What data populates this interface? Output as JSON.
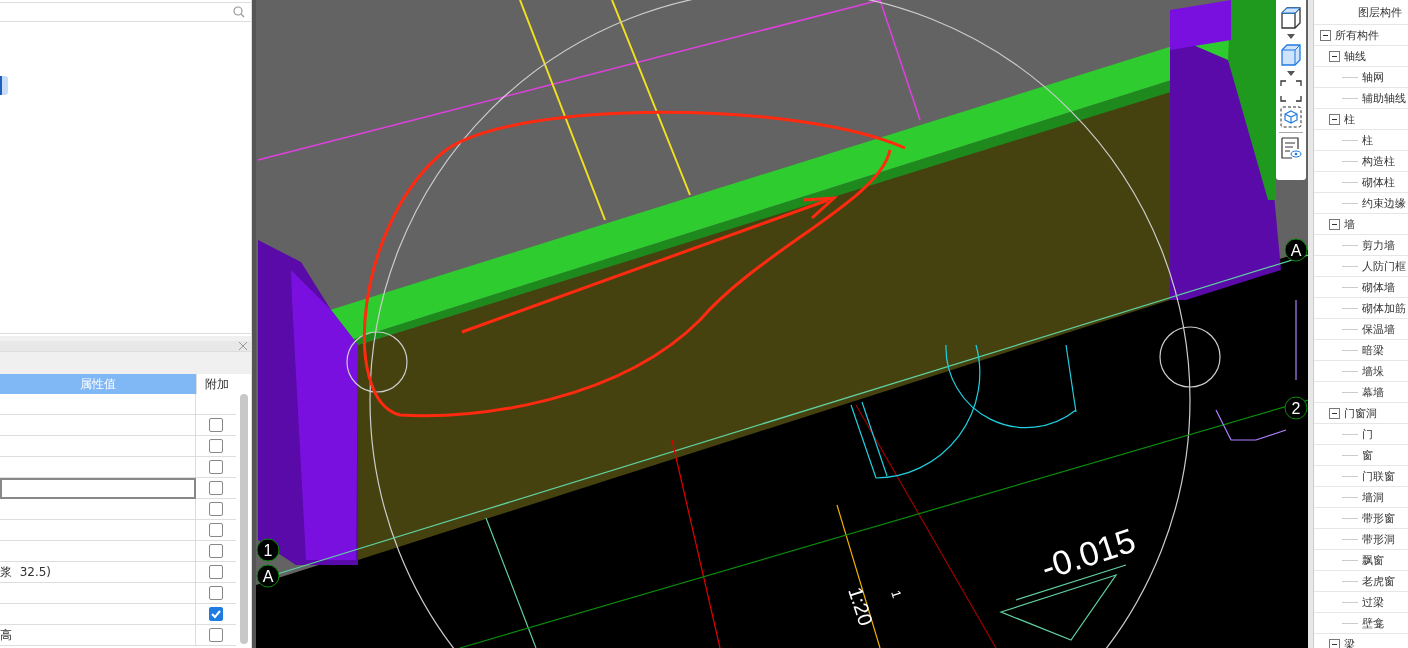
{
  "left_list": {
    "items": [
      {
        "selected": true
      }
    ]
  },
  "properties": {
    "columns": [
      "属性值",
      "附加"
    ],
    "rows": [
      {
        "kind": "group",
        "selected": false
      },
      {
        "kind": "field",
        "checked": false,
        "selected": false
      },
      {
        "kind": "field",
        "checked": false,
        "selected": false
      },
      {
        "kind": "field",
        "checked": false,
        "selected": false
      },
      {
        "kind": "field",
        "checked": false,
        "selected": true
      },
      {
        "kind": "field",
        "checked": false,
        "selected": false
      },
      {
        "kind": "field",
        "checked": false,
        "selected": false
      },
      {
        "kind": "field",
        "checked": false,
        "selected": false
      },
      {
        "kind": "field",
        "value": "浆  32.5)",
        "checked": false,
        "selected": false
      },
      {
        "kind": "field",
        "checked": false,
        "selected": false
      },
      {
        "kind": "field",
        "checked": true,
        "selected": false
      },
      {
        "kind": "field",
        "value": "高",
        "checked": false,
        "selected": false
      }
    ]
  },
  "view": {
    "axis_labels": [
      "A",
      "2",
      "1",
      "A"
    ],
    "elevation": "-0.015",
    "scale": "1:20",
    "tick": "1"
  },
  "tree": {
    "header": "图层构件",
    "items": [
      {
        "label": "所有构件",
        "expanded": true,
        "children": [
          {
            "label": "轴线",
            "expanded": true,
            "children": [
              {
                "label": "轴网"
              },
              {
                "label": "辅助轴线"
              }
            ]
          },
          {
            "label": "柱",
            "expanded": true,
            "children": [
              {
                "label": "柱"
              },
              {
                "label": "构造柱"
              },
              {
                "label": "砌体柱"
              },
              {
                "label": "约束边缘"
              }
            ]
          },
          {
            "label": "墙",
            "expanded": true,
            "children": [
              {
                "label": "剪力墙"
              },
              {
                "label": "人防门框"
              },
              {
                "label": "砌体墙"
              },
              {
                "label": "砌体加筋"
              },
              {
                "label": "保温墙"
              },
              {
                "label": "暗梁"
              },
              {
                "label": "墙垛"
              },
              {
                "label": "幕墙"
              }
            ]
          },
          {
            "label": "门窗洞",
            "expanded": true,
            "children": [
              {
                "label": "门"
              },
              {
                "label": "窗"
              },
              {
                "label": "门联窗"
              },
              {
                "label": "墙洞"
              },
              {
                "label": "带形窗"
              },
              {
                "label": "带形洞"
              },
              {
                "label": "飘窗"
              },
              {
                "label": "老虎窗"
              },
              {
                "label": "过梁"
              },
              {
                "label": "壁龛"
              }
            ]
          },
          {
            "label": "梁",
            "expanded": true
          }
        ]
      }
    ]
  }
}
